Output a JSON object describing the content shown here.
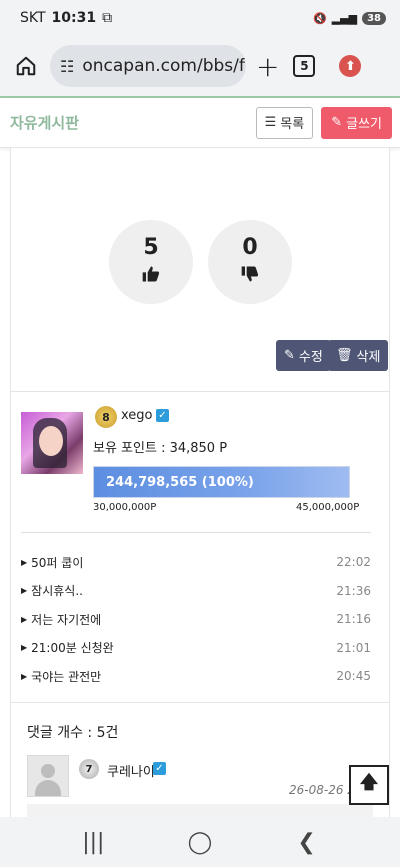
{
  "status_bar": {
    "carrier": "SKT",
    "time": "10:31",
    "battery": "38"
  },
  "browser": {
    "url": "oncapan.com/bbs/fr",
    "tabs_count": "5"
  },
  "board": {
    "title": "자유게시판",
    "list_label": "목록",
    "write_label": "글쓰기"
  },
  "votes": {
    "up": "5",
    "down": "0"
  },
  "post_actions": {
    "edit_label": "수정",
    "delete_label": "삭제"
  },
  "author": {
    "level": "8",
    "name": "xego",
    "points_text": "보유 포인트 : 34,850 P",
    "progress_text": "244,798,565 (100%)",
    "progress_percent": 100,
    "range_min": "30,000,000P",
    "range_max": "45,000,000P"
  },
  "recent_posts": [
    {
      "title": "50퍼 쿱이",
      "time": "22:02"
    },
    {
      "title": "잠시휴식..",
      "time": "21:36"
    },
    {
      "title": "저는 자기전에",
      "time": "21:16"
    },
    {
      "title": "21:00분 신청완",
      "time": "21:01"
    },
    {
      "title": "국야는 관전만",
      "time": "20:45"
    }
  ],
  "comments": {
    "count_text": "댓글 개수 : 5건",
    "first": {
      "level": "7",
      "user": "쿠레나이",
      "date": "26-08-26 22:3"
    }
  },
  "colors": {
    "accent_green": "#8fb99d",
    "write_red": "#ef5b6a",
    "action_navy": "#4f5575",
    "progress_blue": "#5c8ee0"
  },
  "icons": {
    "home": "home-icon",
    "tune": "tune-icon",
    "plus": "plus-icon",
    "upload": "upload-icon",
    "list": "list-icon",
    "pencil": "pencil-icon",
    "thumbs_up": "thumbs-up-icon",
    "thumbs_down": "thumbs-down-icon",
    "edit": "edit-icon",
    "trash": "trash-icon",
    "arrow_up": "arrow-up-icon"
  }
}
